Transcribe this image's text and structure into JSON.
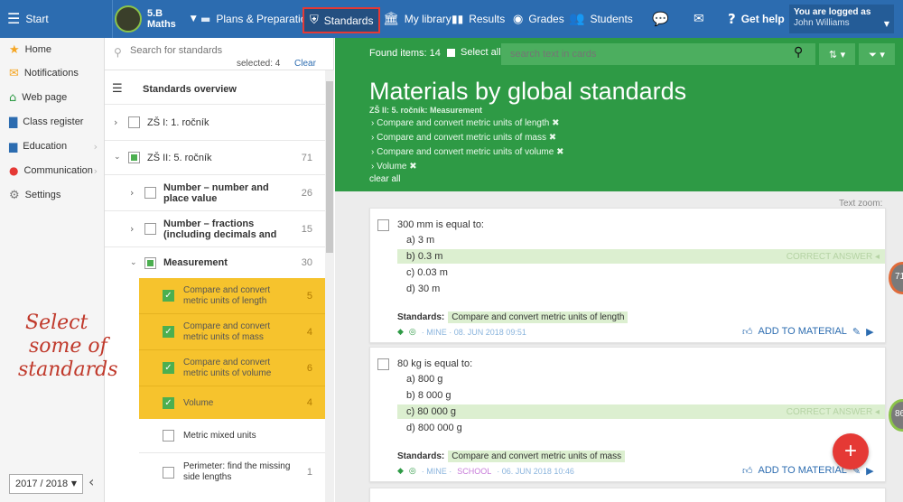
{
  "topbar": {
    "start": "Start",
    "class_name": "5.B",
    "subject": "Maths",
    "plans": "Plans & Preparations",
    "standards": "Standards",
    "library": "My library",
    "results": "Results",
    "grades": "Grades",
    "students": "Students",
    "help": "Get help",
    "logged_as": "You are logged as",
    "user_name": "John Williams"
  },
  "sidebar": {
    "items": [
      {
        "label": "Home",
        "icon": "star-icon"
      },
      {
        "label": "Notifications",
        "icon": "envelope-icon"
      },
      {
        "label": "Web page",
        "icon": "house-icon"
      },
      {
        "label": "Class register",
        "icon": "book-icon"
      },
      {
        "label": "Education",
        "icon": "briefcase-icon"
      },
      {
        "label": "Communication",
        "icon": "chat-icon"
      },
      {
        "label": "Settings",
        "icon": "gear-icon"
      }
    ],
    "year": "2017 / 2018"
  },
  "standards_panel": {
    "search_placeholder": "Search for standards",
    "selected": "selected: 4",
    "clear": "Clear",
    "overview": "Standards overview",
    "rows": [
      {
        "label": "ZŠ I: 1. ročník",
        "count": ""
      },
      {
        "label": "ZŠ II: 5. ročník",
        "count": "71"
      },
      {
        "label": "Number – number and place value",
        "count": "26"
      },
      {
        "label": "Number – fractions (including decimals and",
        "count": "15"
      },
      {
        "label": "Measurement",
        "count": "30"
      },
      {
        "label": "Compare and convert metric units of length",
        "count": "5"
      },
      {
        "label": "Compare and convert metric units of mass",
        "count": "4"
      },
      {
        "label": "Compare and convert metric units of volume",
        "count": "6"
      },
      {
        "label": "Volume",
        "count": "4"
      },
      {
        "label": "Metric mixed units",
        "count": ""
      },
      {
        "label": "Perimeter: find the missing side lengths",
        "count": "1"
      }
    ],
    "annotation": [
      "Select",
      "some of",
      "standards"
    ]
  },
  "main": {
    "found": "Found items: 14",
    "select_all": "Select all",
    "search_placeholder": "search text in cards",
    "heading": "Materials by global standards",
    "filter_group": "ZŠ II: 5. ročník: Measurement",
    "filters": [
      "Compare and convert metric units of length",
      "Compare and convert metric units of mass",
      "Compare and convert metric units of volume",
      "Volume"
    ],
    "clear_all": "clear all",
    "text_zoom": "Text zoom:",
    "cards": [
      {
        "question": "300 mm is equal to:",
        "answers": [
          {
            "key": "a)",
            "text": "3 m"
          },
          {
            "key": "b)",
            "text": "0.3 m"
          },
          {
            "key": "c)",
            "text": "0.03 m"
          },
          {
            "key": "d)",
            "text": "30 m"
          }
        ],
        "correct_label": "CORRECT ANSWER",
        "standards_label": "Standards:",
        "standard": "Compare and convert metric units of length",
        "meta": "· MINE · 08. JUN 2018 09:51",
        "add": "ADD TO MATERIAL",
        "side_badge": "71"
      },
      {
        "question": "80 kg is equal to:",
        "answers": [
          {
            "key": "a)",
            "text": "800 g"
          },
          {
            "key": "b)",
            "text": "8 000 g"
          },
          {
            "key": "c)",
            "text": "80 000 g"
          },
          {
            "key": "d)",
            "text": "800 000 g"
          }
        ],
        "correct_label": "CORRECT ANSWER",
        "standards_label": "Standards:",
        "standard": "Compare and convert metric units of mass",
        "meta_mine": "· MINE ·",
        "meta_school": "SCHOOL",
        "meta_date": "· 06. JUN 2018 10:46",
        "add": "ADD TO MATERIAL",
        "side_badge": "86"
      }
    ],
    "fab": "+"
  },
  "colors": {
    "topbar": "#2c6cb0",
    "green": "#2e9a45",
    "highlight": "#f6c32d",
    "fab": "#e53935",
    "correct": "#dcefd0"
  }
}
